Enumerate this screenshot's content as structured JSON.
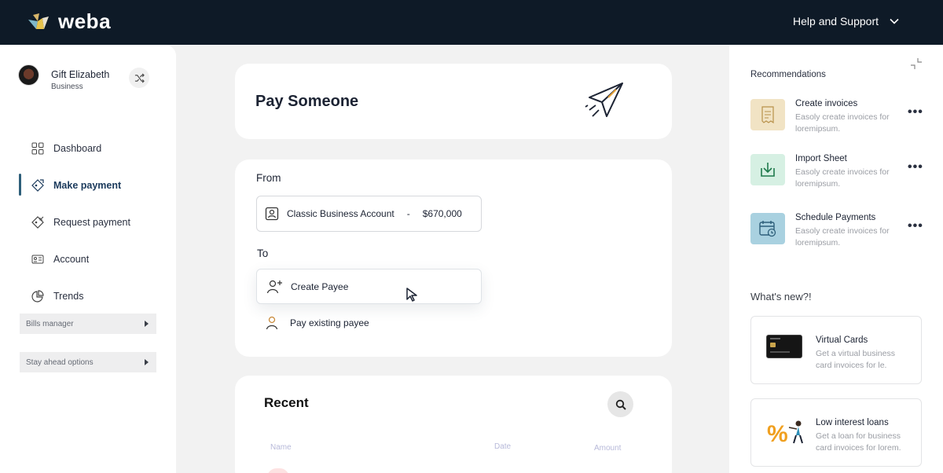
{
  "brand": {
    "name": "weba"
  },
  "header": {
    "help_label": "Help and Support"
  },
  "profile": {
    "name": "Gift Elizabeth",
    "role": "Business"
  },
  "sidebar": {
    "items": [
      {
        "label": "Dashboard",
        "icon": "grid-icon"
      },
      {
        "label": "Make payment",
        "icon": "payment-tag-icon",
        "active": true
      },
      {
        "label": "Request payment",
        "icon": "request-tag-icon"
      },
      {
        "label": "Account",
        "icon": "account-card-icon"
      },
      {
        "label": "Trends",
        "icon": "pie-chart-icon"
      }
    ],
    "collapsibles": [
      "Bills manager",
      "Stay ahead options"
    ]
  },
  "main": {
    "title": "Pay Someone",
    "from_label": "From",
    "account_name": "Classic Business Account",
    "account_sep": "-",
    "account_balance": "$670,000",
    "to_label": "To",
    "create_payee": "Create Payee",
    "existing_payee": "Pay existing payee"
  },
  "recent": {
    "title": "Recent",
    "columns": [
      "Name",
      "Date",
      "Amount"
    ]
  },
  "right": {
    "recommendations_title": "Recommendations",
    "recommendations": [
      {
        "title": "Create invoices",
        "desc": "Easoly create invoices for loremipsum.",
        "icon": "receipt-icon"
      },
      {
        "title": "Import Sheet",
        "desc": "Easoly create invoices for loremipsum.",
        "icon": "import-icon"
      },
      {
        "title": "Schedule Payments",
        "desc": "Easoly create invoices for loremipsum.",
        "icon": "calendar-clock-icon"
      }
    ],
    "whats_new_title": "What's new?!",
    "promos": [
      {
        "title": "Virtual Cards",
        "desc": "Get a virtual business card invoices for le."
      },
      {
        "title": "Low interest loans",
        "desc": "Get a loan for  business card invoices for lorem."
      }
    ]
  },
  "colors": {
    "topbar": "#0e1a27",
    "accent": "#2e5f7a",
    "rec_invoice_bg": "#f1e3c4",
    "rec_import_bg": "#d6f0e3",
    "rec_schedule_bg": "#a9d1e0"
  }
}
